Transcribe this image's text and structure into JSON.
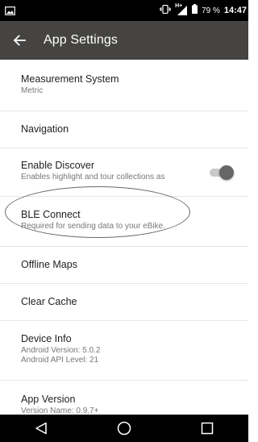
{
  "status_bar": {
    "battery_percent": "79 %",
    "time": "14:47",
    "network": "H+"
  },
  "app_bar": {
    "title": "App Settings",
    "back_icon": "arrow-left-icon"
  },
  "settings": [
    {
      "id": "measurement-system",
      "title": "Measurement System",
      "subtitle": "Metric"
    },
    {
      "id": "navigation",
      "title": "Navigation"
    },
    {
      "id": "enable-discover",
      "title": "Enable Discover",
      "subtitle": "Enables highlight and tour collections as",
      "toggle_on": true
    },
    {
      "id": "ble-connect",
      "title": "BLE Connect",
      "subtitle": "Required for sending data to your eBike."
    },
    {
      "id": "offline-maps",
      "title": "Offline Maps"
    },
    {
      "id": "clear-cache",
      "title": "Clear Cache"
    },
    {
      "id": "device-info",
      "title": "Device Info",
      "subtitle": "Android Version: 5.0.2",
      "subtitle2": "Android API Level: 21"
    },
    {
      "id": "app-version",
      "title": "App Version",
      "subtitle": "Version Name: 0.9.7+"
    }
  ],
  "colors": {
    "app_bar": "#454442",
    "status_bar": "#000000",
    "toggle_thumb": "#666666",
    "toggle_track": "#c9c9c9"
  }
}
